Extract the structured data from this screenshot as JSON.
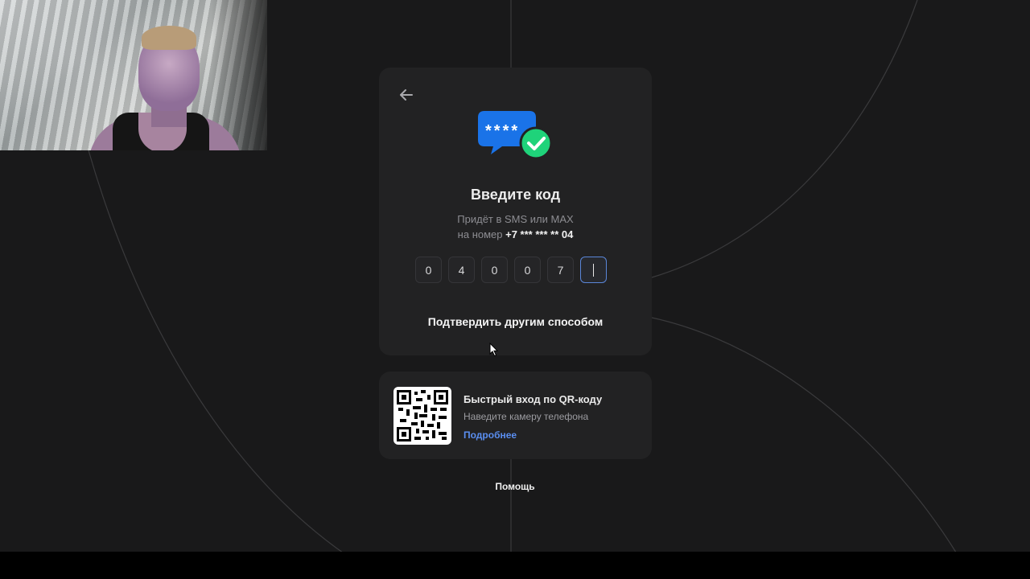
{
  "auth": {
    "title": "Введите код",
    "subtitle_line1": "Придёт в SMS или MAX",
    "subtitle_prefix": "на номер",
    "phone_masked": "+7 *** *** ** 04",
    "code_digits": [
      "0",
      "4",
      "0",
      "0",
      "7",
      ""
    ],
    "alt_method_label": "Подтвердить другим способом",
    "hero_icon_text": "****"
  },
  "qr": {
    "title": "Быстрый вход по QR-коду",
    "subtitle": "Наведите камеру телефона",
    "link": "Подробнее"
  },
  "footer": {
    "help_label": "Помощь"
  },
  "colors": {
    "background": "#19191a",
    "card": "#222223",
    "accent_blue": "#1a73e8",
    "check_green": "#1fd37a",
    "link_blue": "#5a8ef0"
  },
  "icons": [
    "back-arrow-icon",
    "sms-code-icon",
    "check-icon",
    "qr-code-icon",
    "mouse-cursor-icon"
  ]
}
